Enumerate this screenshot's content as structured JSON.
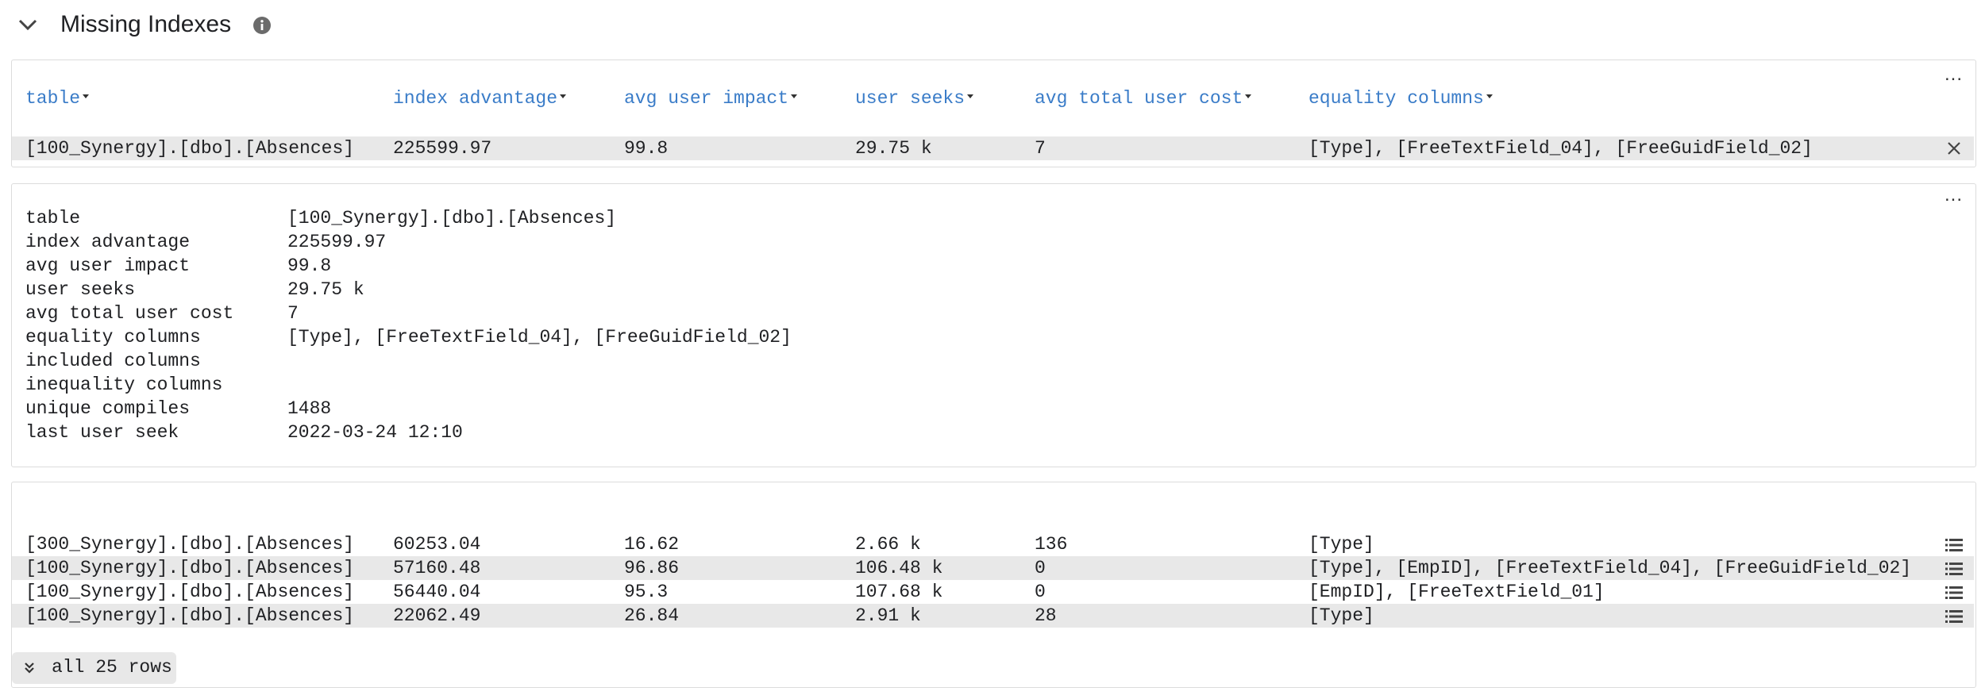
{
  "section": {
    "title": "Missing Indexes",
    "chevron_icon": "chevron-down-icon",
    "info_icon": "info-icon"
  },
  "columns": [
    "table",
    "index advantage",
    "avg user impact",
    "user seeks",
    "avg total user cost",
    "equality columns"
  ],
  "selected_row": {
    "table": "[100_Synergy].[dbo].[Absences]",
    "index_advantage": "225599.97",
    "avg_user_impact": "99.8",
    "user_seeks": "29.75 k",
    "avg_total_user_cost": "7",
    "equality_columns": "[Type], [FreeTextField_04], [FreeGuidField_02]"
  },
  "detail": [
    {
      "key": "table",
      "value": "[100_Synergy].[dbo].[Absences]"
    },
    {
      "key": "index advantage",
      "value": "225599.97"
    },
    {
      "key": "avg user impact",
      "value": "99.8"
    },
    {
      "key": "user seeks",
      "value": "29.75 k"
    },
    {
      "key": "avg total user cost",
      "value": "7"
    },
    {
      "key": "equality columns",
      "value": "[Type], [FreeTextField_04], [FreeGuidField_02]"
    },
    {
      "key": "included columns",
      "value": ""
    },
    {
      "key": "inequality columns",
      "value": ""
    },
    {
      "key": "unique compiles",
      "value": "1488"
    },
    {
      "key": "last user seek",
      "value": "2022-03-24 12:10"
    }
  ],
  "rows": [
    {
      "table": "[300_Synergy].[dbo].[Absences]",
      "index_advantage": "60253.04",
      "avg_user_impact": "16.62",
      "user_seeks": "2.66 k",
      "avg_total_user_cost": "136",
      "equality_columns": "[Type]"
    },
    {
      "table": "[100_Synergy].[dbo].[Absences]",
      "index_advantage": "57160.48",
      "avg_user_impact": "96.86",
      "user_seeks": "106.48 k",
      "avg_total_user_cost": "0",
      "equality_columns": "[Type], [EmpID], [FreeTextField_04], [FreeGuidField_02]"
    },
    {
      "table": "[100_Synergy].[dbo].[Absences]",
      "index_advantage": "56440.04",
      "avg_user_impact": "95.3",
      "user_seeks": "107.68 k",
      "avg_total_user_cost": "0",
      "equality_columns": "[EmpID], [FreeTextField_01]"
    },
    {
      "table": "[100_Synergy].[dbo].[Absences]",
      "index_advantage": "22062.49",
      "avg_user_impact": "26.84",
      "user_seeks": "2.91 k",
      "avg_total_user_cost": "28",
      "equality_columns": "[Type]"
    }
  ],
  "more_menu_label": "...",
  "show_all_label": "all 25 rows",
  "colors": {
    "header_link": "#3a7cc8",
    "row_shade": "#e8e8e8",
    "border": "#dcdcdc"
  }
}
